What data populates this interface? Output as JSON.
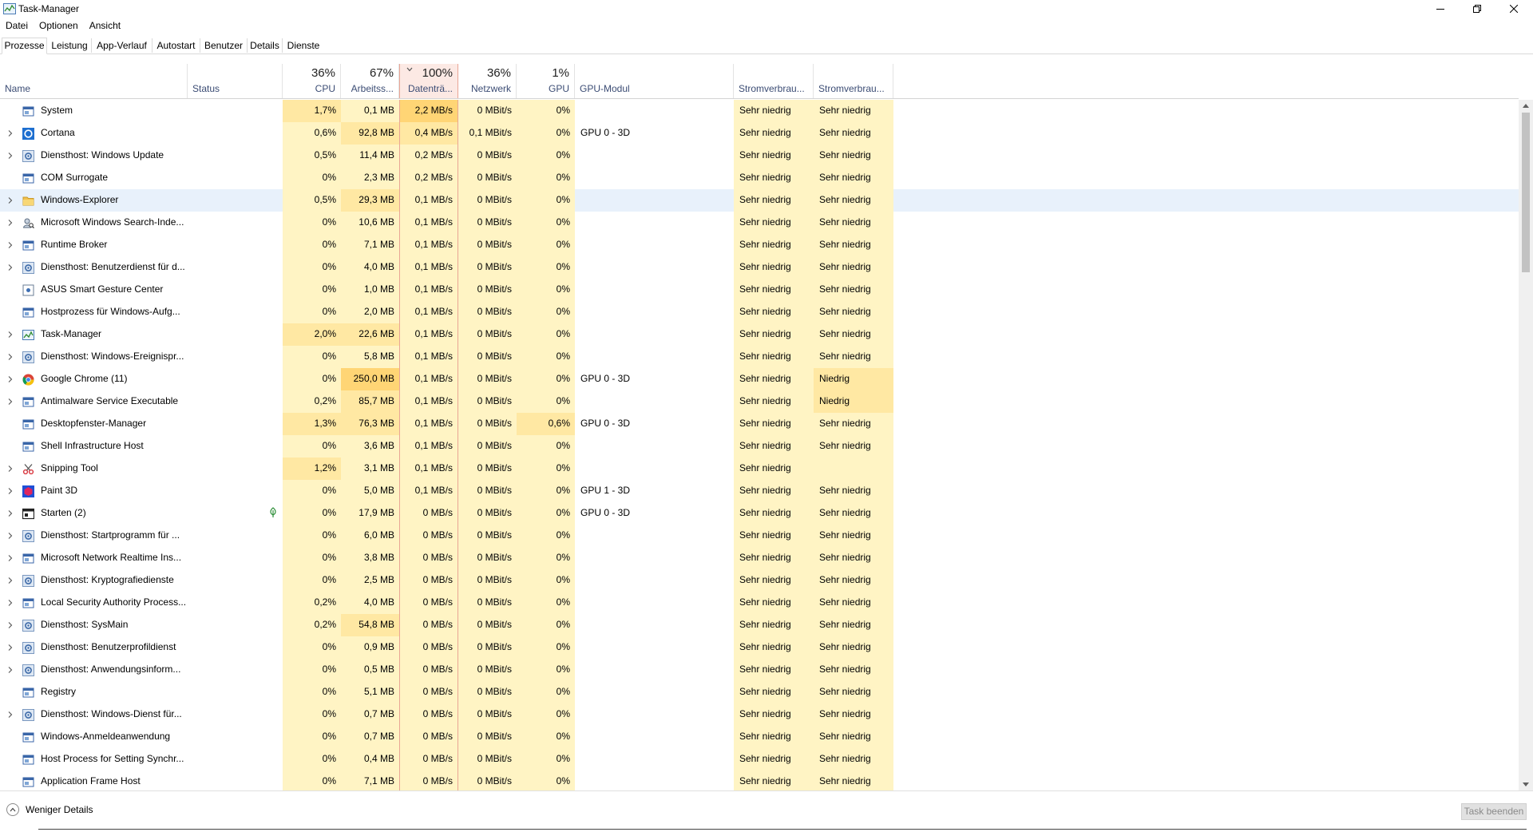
{
  "window": {
    "title": "Task-Manager"
  },
  "menu": [
    "Datei",
    "Optionen",
    "Ansicht"
  ],
  "tabs": [
    "Prozesse",
    "Leistung",
    "App-Verlauf",
    "Autostart",
    "Benutzer",
    "Details",
    "Dienste"
  ],
  "active_tab": "Prozesse",
  "columns": {
    "name": "Name",
    "status": "Status",
    "cpu": {
      "pct": "36%",
      "label": "CPU"
    },
    "mem": {
      "pct": "67%",
      "label": "Arbeitss..."
    },
    "disk": {
      "pct": "100%",
      "label": "Datenträ..."
    },
    "net": {
      "pct": "36%",
      "label": "Netzwerk"
    },
    "gpu": {
      "pct": "1%",
      "label": "GPU"
    },
    "gpu_engine": "GPU-Modul",
    "power": "Stromverbrau...",
    "power_trend": "Stromverbrau..."
  },
  "colors": {
    "heat_light": "#fff4c4",
    "heat_medium": "#ffe8a3",
    "heat_strong": "#ffd575",
    "highlight_row": "#e8f1fb",
    "header_label": "#3b4c74",
    "sorted_header": "#fce9e4"
  },
  "processes": [
    {
      "name": "System",
      "expand": false,
      "icon": "window-icon",
      "cpu": "1,7%",
      "mem": "0,1 MB",
      "disk": "2,2 MB/s",
      "net": "0 MBit/s",
      "gpu": "0%",
      "engine": "",
      "power": "Sehr niedrig",
      "trend": "Sehr niedrig"
    },
    {
      "name": "Cortana",
      "expand": true,
      "icon": "cortana-icon",
      "cpu": "0,6%",
      "mem": "92,8 MB",
      "disk": "0,4 MB/s",
      "net": "0,1 MBit/s",
      "gpu": "0%",
      "engine": "GPU 0 - 3D",
      "power": "Sehr niedrig",
      "trend": "Sehr niedrig"
    },
    {
      "name": "Diensthost: Windows Update",
      "expand": true,
      "icon": "gear-icon",
      "cpu": "0,5%",
      "mem": "11,4 MB",
      "disk": "0,2 MB/s",
      "net": "0 MBit/s",
      "gpu": "0%",
      "engine": "",
      "power": "Sehr niedrig",
      "trend": "Sehr niedrig"
    },
    {
      "name": "COM Surrogate",
      "expand": false,
      "icon": "window-icon",
      "cpu": "0%",
      "mem": "2,3 MB",
      "disk": "0,2 MB/s",
      "net": "0 MBit/s",
      "gpu": "0%",
      "engine": "",
      "power": "Sehr niedrig",
      "trend": "Sehr niedrig"
    },
    {
      "name": "Windows-Explorer",
      "expand": true,
      "icon": "folder-icon",
      "cpu": "0,5%",
      "mem": "29,3 MB",
      "disk": "0,1 MB/s",
      "net": "0 MBit/s",
      "gpu": "0%",
      "engine": "",
      "power": "Sehr niedrig",
      "trend": "Sehr niedrig",
      "highlight": true
    },
    {
      "name": "Microsoft Windows Search-Inde...",
      "expand": true,
      "icon": "search-user-icon",
      "cpu": "0%",
      "mem": "10,6 MB",
      "disk": "0,1 MB/s",
      "net": "0 MBit/s",
      "gpu": "0%",
      "engine": "",
      "power": "Sehr niedrig",
      "trend": "Sehr niedrig"
    },
    {
      "name": "Runtime Broker",
      "expand": true,
      "icon": "window-icon",
      "cpu": "0%",
      "mem": "7,1 MB",
      "disk": "0,1 MB/s",
      "net": "0 MBit/s",
      "gpu": "0%",
      "engine": "",
      "power": "Sehr niedrig",
      "trend": "Sehr niedrig"
    },
    {
      "name": "Diensthost: Benutzerdienst für d...",
      "expand": true,
      "icon": "gear-icon",
      "cpu": "0%",
      "mem": "4,0 MB",
      "disk": "0,1 MB/s",
      "net": "0 MBit/s",
      "gpu": "0%",
      "engine": "",
      "power": "Sehr niedrig",
      "trend": "Sehr niedrig"
    },
    {
      "name": "ASUS Smart Gesture Center",
      "expand": false,
      "icon": "asus-icon",
      "cpu": "0%",
      "mem": "1,0 MB",
      "disk": "0,1 MB/s",
      "net": "0 MBit/s",
      "gpu": "0%",
      "engine": "",
      "power": "Sehr niedrig",
      "trend": "Sehr niedrig"
    },
    {
      "name": "Hostprozess für Windows-Aufg...",
      "expand": false,
      "icon": "window-icon",
      "cpu": "0%",
      "mem": "2,0 MB",
      "disk": "0,1 MB/s",
      "net": "0 MBit/s",
      "gpu": "0%",
      "engine": "",
      "power": "Sehr niedrig",
      "trend": "Sehr niedrig"
    },
    {
      "name": "Task-Manager",
      "expand": true,
      "icon": "taskmgr-icon",
      "cpu": "2,0%",
      "mem": "22,6 MB",
      "disk": "0,1 MB/s",
      "net": "0 MBit/s",
      "gpu": "0%",
      "engine": "",
      "power": "Sehr niedrig",
      "trend": "Sehr niedrig"
    },
    {
      "name": "Diensthost: Windows-Ereignispr...",
      "expand": true,
      "icon": "gear-icon",
      "cpu": "0%",
      "mem": "5,8 MB",
      "disk": "0,1 MB/s",
      "net": "0 MBit/s",
      "gpu": "0%",
      "engine": "",
      "power": "Sehr niedrig",
      "trend": "Sehr niedrig"
    },
    {
      "name": "Google Chrome (11)",
      "expand": true,
      "icon": "chrome-icon",
      "cpu": "0%",
      "mem": "250,0 MB",
      "disk": "0,1 MB/s",
      "net": "0 MBit/s",
      "gpu": "0%",
      "engine": "GPU 0 - 3D",
      "power": "Sehr niedrig",
      "trend": "Niedrig"
    },
    {
      "name": "Antimalware Service Executable",
      "expand": true,
      "icon": "window-icon",
      "cpu": "0,2%",
      "mem": "85,7 MB",
      "disk": "0,1 MB/s",
      "net": "0 MBit/s",
      "gpu": "0%",
      "engine": "",
      "power": "Sehr niedrig",
      "trend": "Niedrig"
    },
    {
      "name": "Desktopfenster-Manager",
      "expand": false,
      "icon": "window-icon",
      "cpu": "1,3%",
      "mem": "76,3 MB",
      "disk": "0,1 MB/s",
      "net": "0 MBit/s",
      "gpu": "0,6%",
      "engine": "GPU 0 - 3D",
      "power": "Sehr niedrig",
      "trend": "Sehr niedrig"
    },
    {
      "name": "Shell Infrastructure Host",
      "expand": false,
      "icon": "window-icon",
      "cpu": "0%",
      "mem": "3,6 MB",
      "disk": "0,1 MB/s",
      "net": "0 MBit/s",
      "gpu": "0%",
      "engine": "",
      "power": "Sehr niedrig",
      "trend": "Sehr niedrig"
    },
    {
      "name": "Snipping Tool",
      "expand": true,
      "icon": "scissors-icon",
      "cpu": "1,2%",
      "mem": "3,1 MB",
      "disk": "0,1 MB/s",
      "net": "0 MBit/s",
      "gpu": "0%",
      "engine": "",
      "power": "Sehr niedrig",
      "trend": ""
    },
    {
      "name": "Paint 3D",
      "expand": true,
      "icon": "paint3d-icon",
      "cpu": "0%",
      "mem": "5,0 MB",
      "disk": "0,1 MB/s",
      "net": "0 MBit/s",
      "gpu": "0%",
      "engine": "GPU 1 - 3D",
      "power": "Sehr niedrig",
      "trend": "Sehr niedrig"
    },
    {
      "name": "Starten (2)",
      "expand": true,
      "icon": "start-icon",
      "cpu": "0%",
      "mem": "17,9 MB",
      "disk": "0 MB/s",
      "net": "0 MBit/s",
      "gpu": "0%",
      "engine": "GPU 0 - 3D",
      "power": "Sehr niedrig",
      "trend": "Sehr niedrig",
      "suspended": true
    },
    {
      "name": "Diensthost: Startprogramm für ...",
      "expand": true,
      "icon": "gear-icon",
      "cpu": "0%",
      "mem": "6,0 MB",
      "disk": "0 MB/s",
      "net": "0 MBit/s",
      "gpu": "0%",
      "engine": "",
      "power": "Sehr niedrig",
      "trend": "Sehr niedrig"
    },
    {
      "name": "Microsoft Network Realtime Ins...",
      "expand": true,
      "icon": "window-icon",
      "cpu": "0%",
      "mem": "3,8 MB",
      "disk": "0 MB/s",
      "net": "0 MBit/s",
      "gpu": "0%",
      "engine": "",
      "power": "Sehr niedrig",
      "trend": "Sehr niedrig"
    },
    {
      "name": "Diensthost: Kryptografiedienste",
      "expand": true,
      "icon": "gear-icon",
      "cpu": "0%",
      "mem": "2,5 MB",
      "disk": "0 MB/s",
      "net": "0 MBit/s",
      "gpu": "0%",
      "engine": "",
      "power": "Sehr niedrig",
      "trend": "Sehr niedrig"
    },
    {
      "name": "Local Security Authority Process...",
      "expand": true,
      "icon": "window-icon",
      "cpu": "0,2%",
      "mem": "4,0 MB",
      "disk": "0 MB/s",
      "net": "0 MBit/s",
      "gpu": "0%",
      "engine": "",
      "power": "Sehr niedrig",
      "trend": "Sehr niedrig"
    },
    {
      "name": "Diensthost: SysMain",
      "expand": true,
      "icon": "gear-icon",
      "cpu": "0,2%",
      "mem": "54,8 MB",
      "disk": "0 MB/s",
      "net": "0 MBit/s",
      "gpu": "0%",
      "engine": "",
      "power": "Sehr niedrig",
      "trend": "Sehr niedrig"
    },
    {
      "name": "Diensthost: Benutzerprofildienst",
      "expand": true,
      "icon": "gear-icon",
      "cpu": "0%",
      "mem": "0,9 MB",
      "disk": "0 MB/s",
      "net": "0 MBit/s",
      "gpu": "0%",
      "engine": "",
      "power": "Sehr niedrig",
      "trend": "Sehr niedrig"
    },
    {
      "name": "Diensthost: Anwendungsinform...",
      "expand": true,
      "icon": "gear-icon",
      "cpu": "0%",
      "mem": "0,5 MB",
      "disk": "0 MB/s",
      "net": "0 MBit/s",
      "gpu": "0%",
      "engine": "",
      "power": "Sehr niedrig",
      "trend": "Sehr niedrig"
    },
    {
      "name": "Registry",
      "expand": false,
      "icon": "window-icon",
      "cpu": "0%",
      "mem": "5,1 MB",
      "disk": "0 MB/s",
      "net": "0 MBit/s",
      "gpu": "0%",
      "engine": "",
      "power": "Sehr niedrig",
      "trend": "Sehr niedrig"
    },
    {
      "name": "Diensthost: Windows-Dienst für...",
      "expand": true,
      "icon": "gear-icon",
      "cpu": "0%",
      "mem": "0,7 MB",
      "disk": "0 MB/s",
      "net": "0 MBit/s",
      "gpu": "0%",
      "engine": "",
      "power": "Sehr niedrig",
      "trend": "Sehr niedrig"
    },
    {
      "name": "Windows-Anmeldeanwendung",
      "expand": false,
      "icon": "window-icon",
      "cpu": "0%",
      "mem": "0,7 MB",
      "disk": "0 MB/s",
      "net": "0 MBit/s",
      "gpu": "0%",
      "engine": "",
      "power": "Sehr niedrig",
      "trend": "Sehr niedrig"
    },
    {
      "name": "Host Process for Setting Synchr...",
      "expand": false,
      "icon": "window-icon",
      "cpu": "0%",
      "mem": "0,4 MB",
      "disk": "0 MB/s",
      "net": "0 MBit/s",
      "gpu": "0%",
      "engine": "",
      "power": "Sehr niedrig",
      "trend": "Sehr niedrig"
    },
    {
      "name": "Application Frame Host",
      "expand": false,
      "icon": "window-icon",
      "cpu": "0%",
      "mem": "7,1 MB",
      "disk": "0 MB/s",
      "net": "0 MBit/s",
      "gpu": "0%",
      "engine": "",
      "power": "Sehr niedrig",
      "trend": "Sehr niedrig"
    }
  ],
  "footer": {
    "fewer_details": "Weniger Details",
    "end_task": "Task beenden"
  }
}
